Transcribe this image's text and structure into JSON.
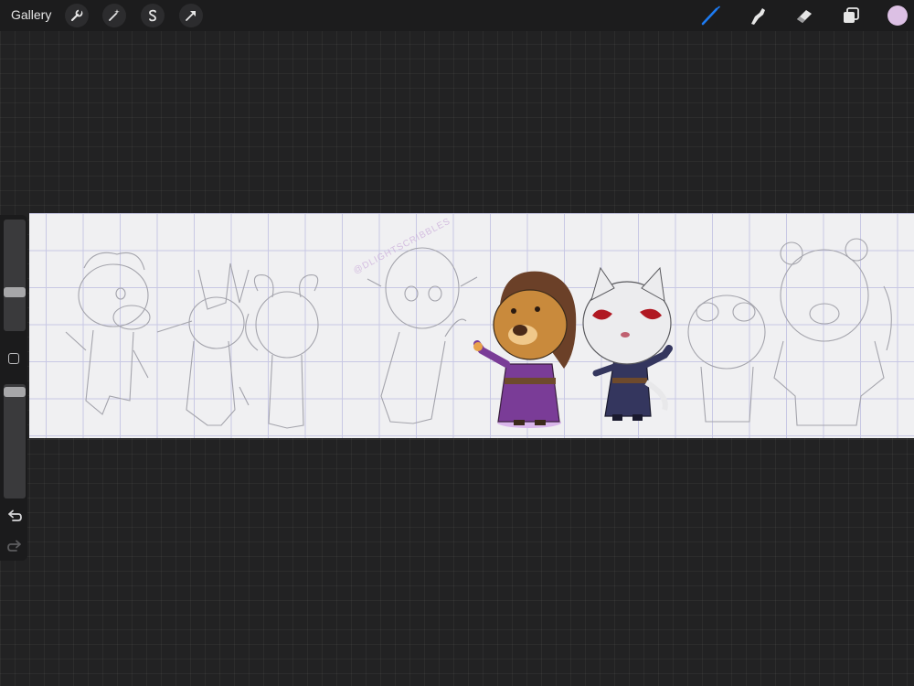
{
  "toolbar": {
    "gallery_label": "Gallery",
    "left_tools": [
      "wrench-icon",
      "magic-wand-icon",
      "selection-s-icon",
      "transform-arrow-icon"
    ],
    "right_tools": [
      "brush-icon",
      "smudge-icon",
      "eraser-icon",
      "layers-icon"
    ],
    "active_tool": "brush-icon",
    "active_color": "#dcc0e4",
    "active_tool_color": "#1d7bf2"
  },
  "sidebar": {
    "brush_size_level": 0.45,
    "opacity_level": 1.0,
    "items": [
      "brush-size-slider",
      "modify-button",
      "opacity-slider",
      "undo-button",
      "redo-button"
    ]
  },
  "canvas": {
    "watermark": "@DLIGHTSCRIBBLES",
    "background": "#f0f0f2",
    "grid_color": "#c8c8e4"
  }
}
